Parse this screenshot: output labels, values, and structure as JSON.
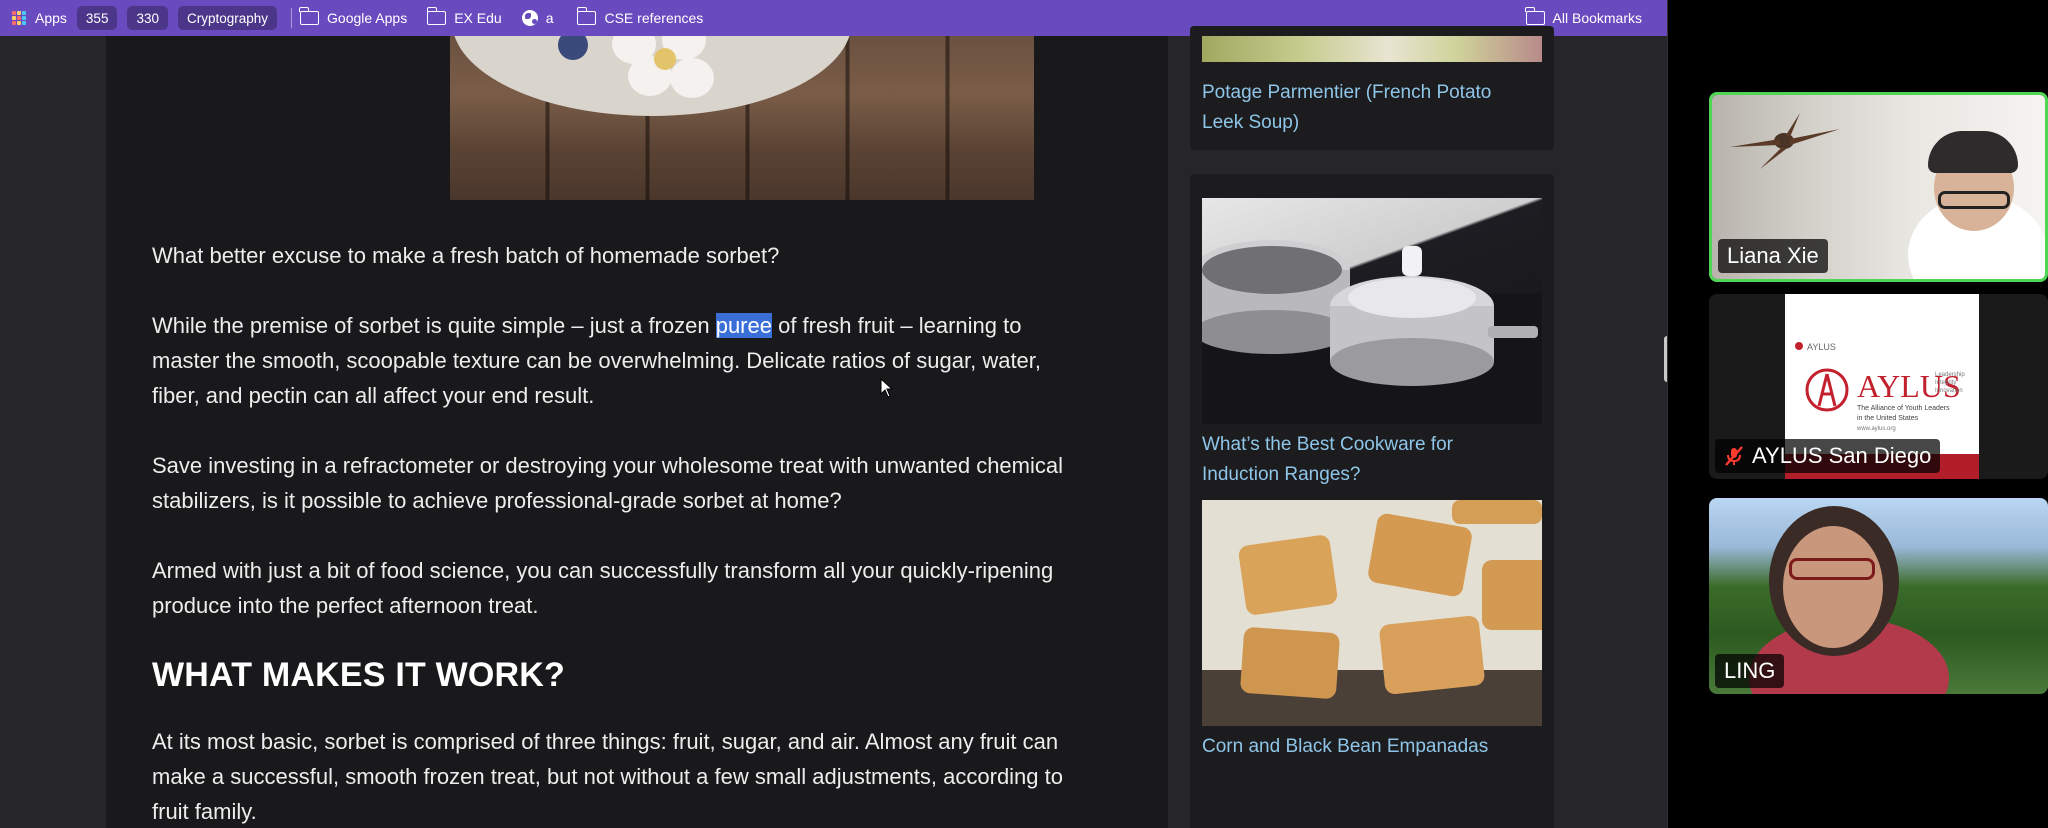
{
  "bookmarks": {
    "apps_label": "Apps",
    "badge1": "355",
    "badge2": "330",
    "pill_label": "Cryptography",
    "folders": [
      "Google Apps",
      "EX Edu"
    ],
    "globe_label": "a",
    "cse_label": "CSE references",
    "all_label": "All Bookmarks"
  },
  "article": {
    "p1": "What better excuse to make a fresh batch of homemade sorbet?",
    "p2_before": "While the premise of sorbet is quite simple – just a frozen ",
    "p2_highlight": "puree",
    "p2_after_line1": " of fresh fruit – learning to",
    "p2_line2": "master the smooth, scoopable texture can be overwhelming. Delicate ratios of sugar, water,",
    "p2_line3": "fiber, and pectin can all affect your end result.",
    "p3_line1": "Save investing in a refractometer or destroying your wholesome treat with unwanted chemical",
    "p3_line2": "stabilizers, is it possible to achieve professional-grade sorbet at home?",
    "p4_line1": "Armed with just a bit of food science, you can successfully transform all your quickly-ripening",
    "p4_line2": "produce into the perfect afternoon treat.",
    "heading": "WHAT MAKES IT WORK?",
    "p5_line1": "At its most basic, sorbet is comprised of three things: fruit, sugar, and air. Almost any fruit can",
    "p5_line2": "make a successful, smooth frozen treat, but not without a few small adjustments, according to",
    "p5_line3": "fruit family."
  },
  "sidebar": {
    "card1_line1": "Potage Parmentier (French Potato",
    "card1_line2": "Leek Soup)",
    "card2_line1": "What’s the Best Cookware for",
    "card2_line2": "Induction Ranges?",
    "card3_line1": "Corn and Black Bean Empanadas"
  },
  "video": {
    "p1_name": "Liana Xie",
    "p2_name": "AYLUS San Diego",
    "p2_muted": true,
    "p3_name": "LING",
    "aylus_small": "AYLUS",
    "aylus_big": "AYLUS",
    "aylus_tag1": "Leadership",
    "aylus_tag2": "Integrity",
    "aylus_tag3": "Innovation",
    "aylus_full1": "The Alliance of Youth Leaders",
    "aylus_full2": "in the United States",
    "aylus_url": "www.aylus.org"
  },
  "colors": {
    "bookmark_bar": "#6a4bbf",
    "link": "#8ec5e8",
    "highlight": "#3a6fd8",
    "active_speaker": "#4fd655"
  }
}
